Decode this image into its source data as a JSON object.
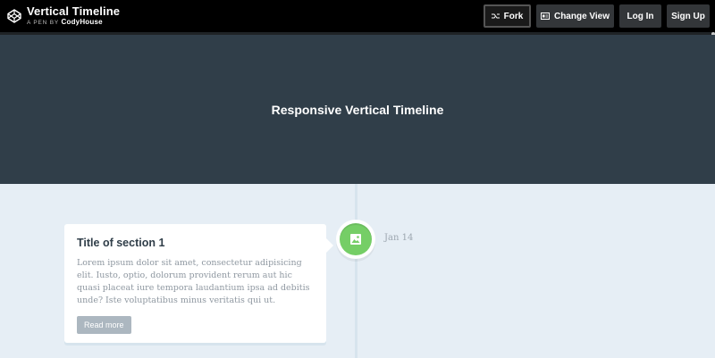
{
  "topbar": {
    "title": "Vertical Timeline",
    "subtitle_prefix": "A PEN BY",
    "author": "CodyHouse",
    "buttons": {
      "fork": "Fork",
      "change_view": "Change View",
      "login": "Log In",
      "signup": "Sign Up"
    }
  },
  "hero": {
    "title": "Responsive Vertical Timeline"
  },
  "timeline": {
    "items": [
      {
        "title": "Title of section 1",
        "text": "Lorem ipsum dolor sit amet, consectetur adipisicing elit. Iusto, optio, dolorum provident rerum aut hic quasi placeat iure tempora laudantium ipsa ad debitis unde? Iste voluptatibus minus veritatis qui ut.",
        "button": "Read more",
        "date": "Jan 14",
        "icon": "image-icon",
        "color": "#75ce66"
      }
    ]
  },
  "colors": {
    "topbar": "#000000",
    "hero": "#303e49",
    "background": "#e6eef5",
    "accent": "#75ce66"
  }
}
